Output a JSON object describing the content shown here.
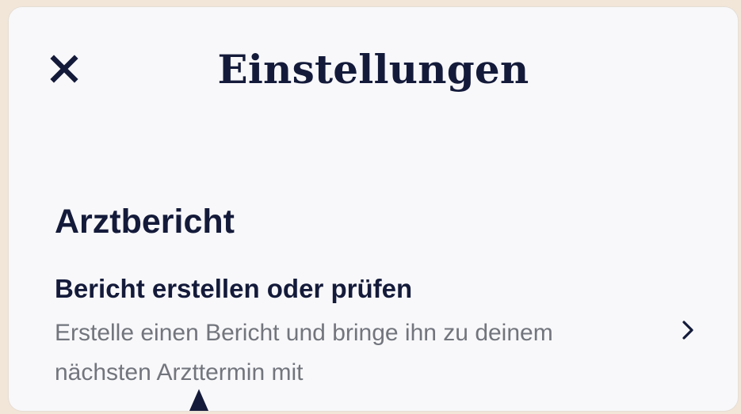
{
  "header": {
    "title": "Einstellungen",
    "close_icon": "close-icon"
  },
  "section": {
    "heading": "Arztbericht",
    "items": [
      {
        "title": "Bericht erstellen oder prüfen",
        "description": "Erstelle einen Bericht und bringe ihn zu deinem nächsten Arzttermin mit",
        "icon": "chevron-right-icon"
      }
    ]
  },
  "colors": {
    "background": "#f2e6d9",
    "panel": "#f8f8fa",
    "text_primary": "#141b3a",
    "text_secondary": "#72757d"
  }
}
